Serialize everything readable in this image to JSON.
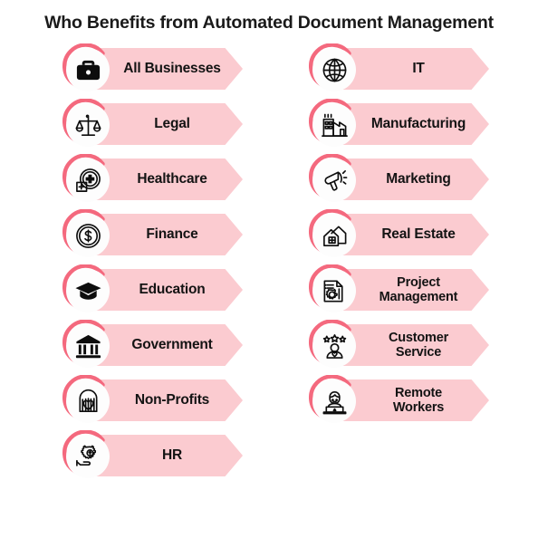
{
  "header": {
    "title": "Who Benefits from Automated Document Management"
  },
  "theme": {
    "ring_color": "#f4697e",
    "banner_color": "#fbcbd0",
    "badge_fill": "#fdfdfd",
    "text_color": "#131313",
    "title_color": "#1a1a1a",
    "background": "#ffffff"
  },
  "columns": {
    "left": {
      "items": [
        {
          "label": "All Businesses",
          "icon": "briefcase-icon",
          "lines": 1
        },
        {
          "label": "Legal",
          "icon": "scales-of-justice-icon",
          "lines": 1
        },
        {
          "label": "Healthcare",
          "icon": "medical-cross-icon",
          "lines": 1
        },
        {
          "label": "Finance",
          "icon": "dollar-coin-icon",
          "lines": 1
        },
        {
          "label": "Education",
          "icon": "graduation-cap-icon",
          "lines": 1
        },
        {
          "label": "Government",
          "icon": "government-building-icon",
          "lines": 1
        },
        {
          "label": "Non-Profits",
          "icon": "hands-heart-icon",
          "lines": 1
        },
        {
          "label": "HR",
          "icon": "hand-gear-icon",
          "lines": 1
        }
      ]
    },
    "right": {
      "items": [
        {
          "label": "IT",
          "icon": "globe-icon",
          "lines": 1
        },
        {
          "label": "Manufacturing",
          "icon": "factory-icon",
          "lines": 1
        },
        {
          "label": "Marketing",
          "icon": "megaphone-icon",
          "lines": 1
        },
        {
          "label": "Real Estate",
          "icon": "houses-icon",
          "lines": 1
        },
        {
          "label": "Project Management",
          "icon": "document-gear-icon",
          "lines": 2
        },
        {
          "label": "Customer Service",
          "icon": "person-stars-icon",
          "lines": 2
        },
        {
          "label": "Remote Workers",
          "icon": "person-laptop-icon",
          "lines": 2
        }
      ]
    }
  }
}
